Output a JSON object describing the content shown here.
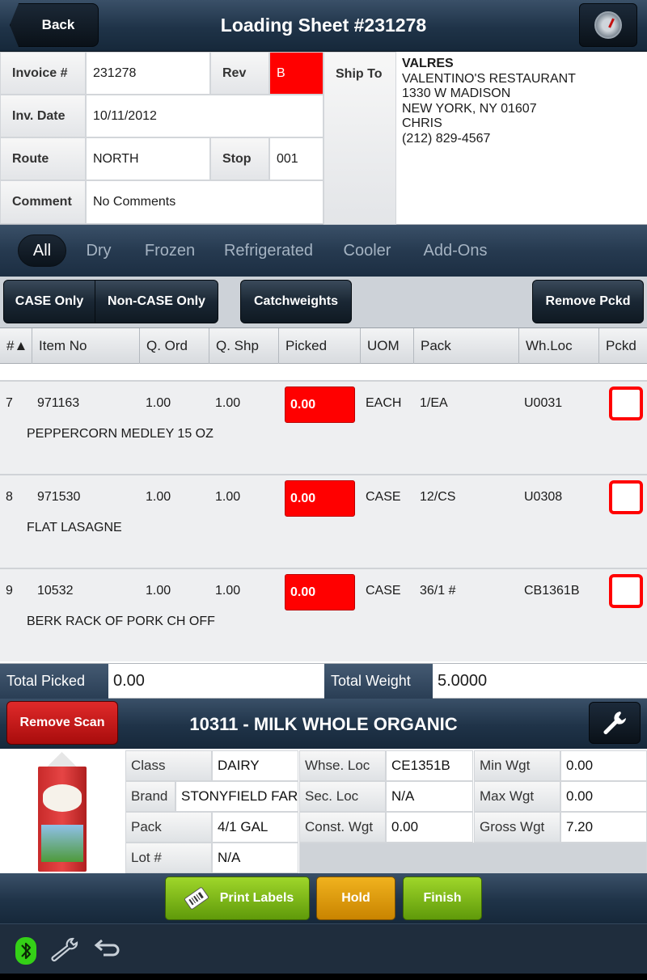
{
  "header": {
    "back_label": "Back",
    "title": "Loading Sheet #231278",
    "dashboard_icon": "gauge-icon"
  },
  "info": {
    "invoice_label": "Invoice #",
    "invoice_value": "231278",
    "rev_label": "Rev",
    "rev_value": "B",
    "inv_date_label": "Inv. Date",
    "inv_date_value": "10/11/2012",
    "route_label": "Route",
    "route_value": "NORTH",
    "stop_label": "Stop",
    "stop_value": "001",
    "comment_label": "Comment",
    "comment_value": "No Comments",
    "ship_to_label": "Ship To",
    "ship_to": {
      "code": "VALRES",
      "name": "VALENTINO'S RESTAURANT",
      "street": "1330 W MADISON",
      "city": "NEW YORK, NY 01607",
      "contact": "CHRIS",
      "phone": "(212) 829-4567"
    }
  },
  "tabs": [
    "All",
    "Dry",
    "Frozen",
    "Refrigerated",
    "Cooler",
    "Add-Ons"
  ],
  "active_tab": "All",
  "filters": {
    "case_only": "CASE Only",
    "non_case_only": "Non-CASE Only",
    "catchweights": "Catchweights",
    "remove_pckd": "Remove Pckd"
  },
  "table": {
    "columns": [
      "#▲",
      "Item No",
      "Q. Ord",
      "Q. Shp",
      "Picked",
      "UOM",
      "Pack",
      "Wh.Loc",
      "Pckd"
    ],
    "rows": [
      {
        "num": "7",
        "item_no": "971163",
        "q_ord": "1.00",
        "q_shp": "1.00",
        "picked": "0.00",
        "uom": "EACH",
        "pack": "1/EA",
        "wh_loc": "U0031",
        "description": "PEPPERCORN MEDLEY 15 OZ"
      },
      {
        "num": "8",
        "item_no": "971530",
        "q_ord": "1.00",
        "q_shp": "1.00",
        "picked": "0.00",
        "uom": "CASE",
        "pack": "12/CS",
        "wh_loc": "U0308",
        "description": "FLAT LASAGNE"
      },
      {
        "num": "9",
        "item_no": "10532",
        "q_ord": "1.00",
        "q_shp": "1.00",
        "picked": "0.00",
        "uom": "CASE",
        "pack": "36/1 #",
        "wh_loc": "CB1361B",
        "description": "BERK RACK OF PORK CH OFF"
      }
    ]
  },
  "totals": {
    "picked_label": "Total Picked",
    "picked_value": "0.00",
    "weight_label": "Total Weight",
    "weight_value": "5.0000"
  },
  "item": {
    "remove_scan_label": "Remove Scan",
    "title": "10311 - MILK WHOLE ORGANIC",
    "class_label": "Class",
    "class_value": "DAIRY",
    "brand_label": "Brand",
    "brand_value": "STONYFIELD FAR",
    "pack_label": "Pack",
    "pack_value": "4/1 GAL",
    "lot_label": "Lot #",
    "lot_value": "N/A",
    "whse_loc_label": "Whse. Loc",
    "whse_loc_value": "CE1351B",
    "sec_loc_label": "Sec. Loc",
    "sec_loc_value": "N/A",
    "const_wgt_label": "Const. Wgt",
    "const_wgt_value": "0.00",
    "min_wgt_label": "Min Wgt",
    "min_wgt_value": "0.00",
    "max_wgt_label": "Max Wgt",
    "max_wgt_value": "0.00",
    "gross_wgt_label": "Gross Wgt",
    "gross_wgt_value": "7.20"
  },
  "actions": {
    "print_labels": "Print Labels",
    "hold": "Hold",
    "finish": "Finish"
  },
  "colors": {
    "alert_red": "#ff0000",
    "nav_blue": "#1f3348",
    "action_green": "#7ab81a",
    "hold_amber": "#e0a010",
    "bluetooth_green": "#34d017"
  }
}
